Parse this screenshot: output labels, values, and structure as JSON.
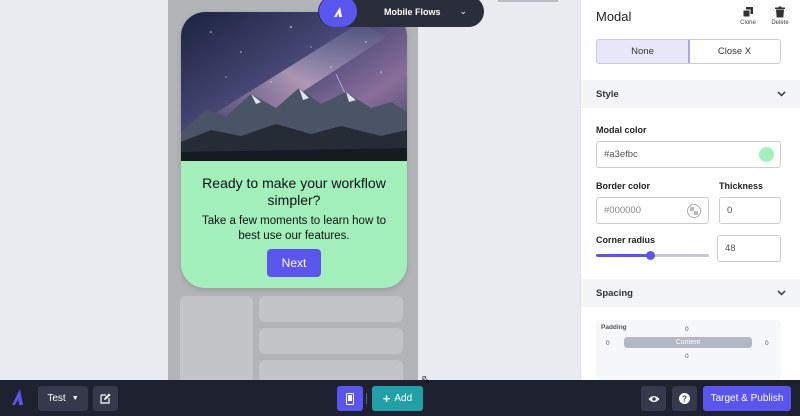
{
  "flow_selector": {
    "label": "Mobile Flows"
  },
  "modal_preview": {
    "title": "Ready to make your workflow simpler?",
    "body": "Take a few moments to learn how to best use our features.",
    "button_label": "Next",
    "background_color": "#a3efbc",
    "button_color": "#5b55f0"
  },
  "panel": {
    "title": "Modal",
    "actions": {
      "clone": "Clone",
      "delete": "Delete"
    },
    "close_options": [
      "None",
      "Close X"
    ],
    "selected_close_option": "None",
    "style_section": "Style",
    "modal_color_label": "Modal color",
    "modal_color_value": "#a3efbc",
    "border_color_label": "Border color",
    "border_color_placeholder": "#000000",
    "thickness_label": "Thickness",
    "thickness_value": "0",
    "corner_radius_label": "Corner radius",
    "corner_radius_value": "48",
    "corner_radius_slider_fraction": 0.48,
    "spacing_section": "Spacing",
    "padding": {
      "label": "Padding",
      "top": "0",
      "left": "0",
      "right": "0",
      "bottom": "0",
      "content_label": "Content"
    }
  },
  "toolbar": {
    "flow_name": "Test",
    "add_label": "Add",
    "publish_label": "Target & Publish"
  },
  "colors": {
    "accent": "#5b55f0",
    "toolbar_bg": "#1e2230",
    "add_bg": "#22a0a8"
  }
}
